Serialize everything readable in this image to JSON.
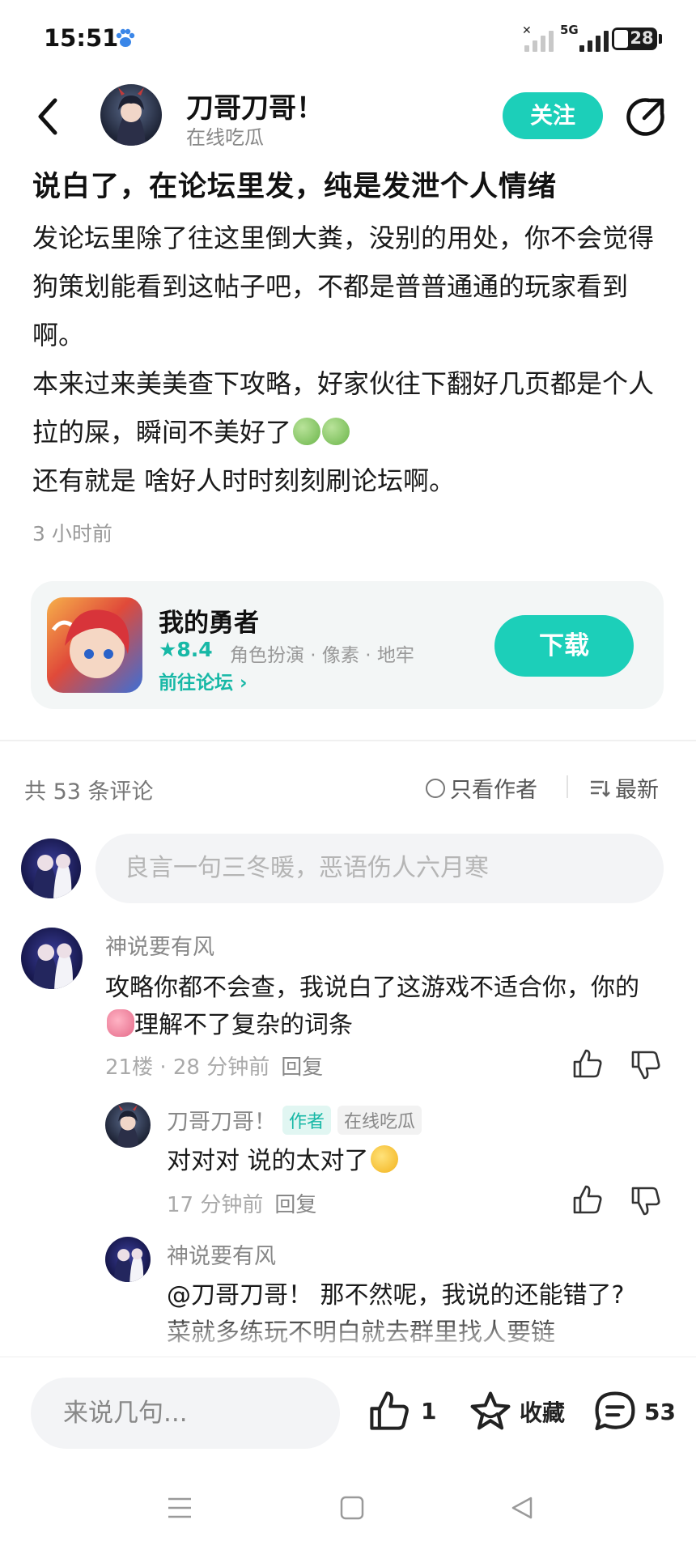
{
  "status_bar": {
    "time": "15:51",
    "network": "5G",
    "battery": "28",
    "notification_icon": "paw-icon"
  },
  "header": {
    "author_name": "刀哥刀哥！",
    "author_status": "在线吃瓜",
    "follow_label": "关注",
    "back_icon": "chevron-left-icon",
    "share_icon": "share-icon"
  },
  "post": {
    "title": "说白了，在论坛里发，纯是发泄个人情绪",
    "paragraphs": [
      "发论坛里除了往这里倒大粪，没别的用处，你不会觉得狗策划能看到这帖子吧，不都是普普通通的玩家看到啊。",
      "本来过来美美查下攻略，好家伙往下翻好几页都是个人拉的屎，瞬间不美好了",
      "还有就是 啥好人时时刻刻刷论坛啊。"
    ],
    "time": "3 小时前"
  },
  "game_card": {
    "name": "我的勇者",
    "rating": "★8.4",
    "tags": "角色扮演 · 像素 · 地牢",
    "forum_link": "前往论坛 ›",
    "download_label": "下载"
  },
  "comments_header": {
    "count_label": "共 53 条评论",
    "author_only_label": "只看作者",
    "sort_label": "最新"
  },
  "comment_input": {
    "placeholder": "良言一句三冬暖，恶语伤人六月寒"
  },
  "comments": [
    {
      "user": "神说要有风",
      "text_before": "攻略你都不会查，我说白了这游戏不适合你，你的",
      "text_after": "理解不了复杂的词条",
      "meta": "21楼 · 28 分钟前",
      "reply_label": "回复"
    }
  ],
  "replies": [
    {
      "user": "刀哥刀哥！",
      "badge_author": "作者",
      "badge_status": "在线吃瓜",
      "text": "对对对 说的太对了",
      "meta": "17 分钟前",
      "reply_label": "回复"
    },
    {
      "user": "神说要有风",
      "text": "@刀哥刀哥！ 那不然呢，我说的还能错了?菜就多练玩不明白就去群里找人要链"
    }
  ],
  "bottom_bar": {
    "input_placeholder": "来说几句...",
    "like_count": "1",
    "favorite_label": "收藏",
    "comment_count": "53"
  },
  "colors": {
    "accent": "#1ccfb9",
    "accent_text": "#17b8a6"
  }
}
